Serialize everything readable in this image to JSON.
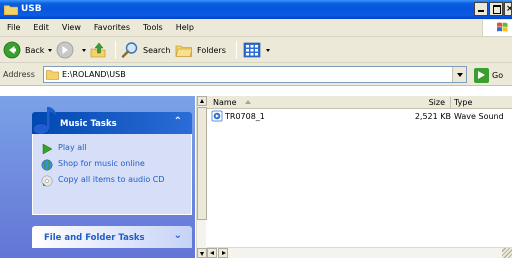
{
  "window": {
    "title": "USB"
  },
  "menu": [
    "File",
    "Edit",
    "View",
    "Favorites",
    "Tools",
    "Help"
  ],
  "toolbar": {
    "back_label": "Back",
    "search_label": "Search",
    "folders_label": "Folders"
  },
  "address": {
    "label": "Address",
    "value": "E:\\ROLAND\\USB",
    "go_label": "Go"
  },
  "tasks": {
    "music_title": "Music Tasks",
    "music_items": [
      "Play all",
      "Shop for music online",
      "Copy all items to audio CD"
    ],
    "file_folder_title": "File and Folder Tasks"
  },
  "files": {
    "columns": {
      "name": "Name",
      "size": "Size",
      "type": "Type"
    },
    "rows": [
      {
        "name": "TR0708_1",
        "size": "2,521 KB",
        "type": "Wave Sound"
      }
    ]
  },
  "colors": {
    "title_bar": "#0855dd",
    "task_pane": "#7ba2e7",
    "task_link": "#215dc6",
    "chrome": "#ece9d8"
  }
}
